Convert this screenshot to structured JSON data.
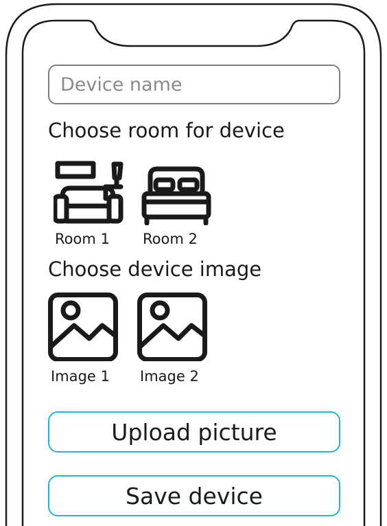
{
  "form": {
    "device_name": {
      "value": "",
      "placeholder": "Device name"
    },
    "room_section_title": "Choose room for device",
    "rooms": [
      {
        "label": "Room 1",
        "icon": "living-room-icon"
      },
      {
        "label": "Room 2",
        "icon": "bed-icon"
      }
    ],
    "image_section_title": "Choose device image",
    "images": [
      {
        "label": "Image 1",
        "icon": "image-icon"
      },
      {
        "label": "Image 2",
        "icon": "image-icon"
      }
    ],
    "upload_label": "Upload picture",
    "save_label": "Save device"
  },
  "colors": {
    "outline": "#1a1a1a",
    "input_border": "#7d7d7d",
    "placeholder": "#8a8a8a",
    "button_border": "#1fb3db",
    "background": "#ffffff"
  }
}
